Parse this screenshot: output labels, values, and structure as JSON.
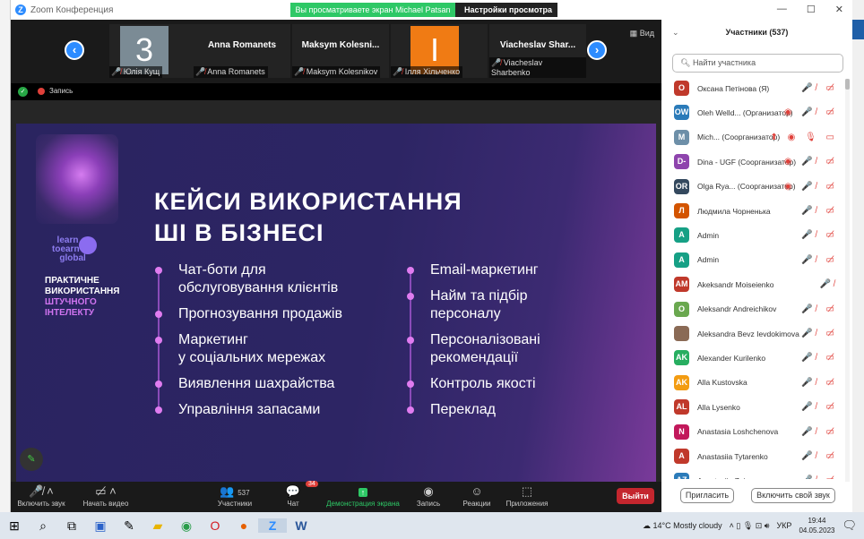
{
  "window": {
    "title": "Zoom Конференция",
    "min": "—",
    "max": "☐",
    "close": "✕"
  },
  "share_banner": {
    "text": "Вы просматриваете экран Michael Patsan",
    "settings": "Настройки просмотра",
    "chevron": "⌄"
  },
  "strip": {
    "tiles": [
      {
        "avatar": "3",
        "avatar_color": "#7b8b95",
        "label": "Юлія Кущ"
      },
      {
        "name": "Anna Romanets",
        "label": "Anna Romanets"
      },
      {
        "name": "Maksym  Kolesni...",
        "label": "Maksym Kolesnikov"
      },
      {
        "avatar": "I",
        "avatar_color": "#f07b14",
        "label": "Ілля Хільченко"
      },
      {
        "name": "Viacheslav  Shar...",
        "label": "Viacheslav Sharbenko"
      }
    ],
    "view": "Вид"
  },
  "recording": {
    "label": "Запись"
  },
  "slide": {
    "title_line1": "КЕЙСИ ВИКОРИСТАННЯ",
    "title_line2": "ШІ В БІЗНЕСІ",
    "logo": [
      "learn",
      "toearn",
      "global"
    ],
    "subtitle_white": [
      "ПРАКТИЧНЕ",
      "ВИКОРИСТАННЯ"
    ],
    "subtitle_pink": [
      "ШТУЧНОГО",
      "ІНТЕЛЕКТУ"
    ],
    "left": [
      "Чат-боти для\nобслуговування клієнтів",
      "Прогнозування продажів",
      "Маркетинг\nу соціальних мережах",
      "Виявлення шахрайства",
      "Управління запасами"
    ],
    "right": [
      "Email-маркетинг",
      "Найм та підбір\nперсоналу",
      "Персоналізовані\nрекомендації",
      "Контроль якості",
      "Переклад"
    ]
  },
  "toolbar": {
    "audio": "Включить звук",
    "video": "Начать видео",
    "participants": "Участники",
    "participants_count": "537",
    "chat": "Чат",
    "chat_badge": "34",
    "share": "Демонстрация экрана",
    "record": "Запись",
    "reactions": "Реакции",
    "apps": "Приложения",
    "leave": "Выйти"
  },
  "panel": {
    "title": "Участники (537)",
    "search_placeholder": "Найти участника",
    "invite": "Пригласить",
    "unmute": "Включить свой звук",
    "participants": [
      {
        "initials": "О",
        "color": "#c0392b",
        "name": "Оксана Петінова (Я)",
        "icons": "🎤̸ ▭̸"
      },
      {
        "initials": "OW",
        "color": "#2b7bb9",
        "name": "Oleh Welld...  (Организатор)",
        "icons": "◉ 🎤̸ ▭̸"
      },
      {
        "initials": "M",
        "color": "#6d8fa8",
        "name": "Mich...  (Соорганизатор)",
        "icons": "⬆ ◉ 🎙 ▭"
      },
      {
        "initials": "D-",
        "color": "#8e44ad",
        "name": "Dina - UGF (Соорганизатор)",
        "icons": "◉ 🎤̸ ▭̸"
      },
      {
        "initials": "OR",
        "color": "#34495e",
        "name": "Olga Rya...  (Соорганизатор)",
        "icons": "◉ 🎤̸ ▭̸"
      },
      {
        "initials": "Л",
        "color": "#d35400",
        "name": "Людмила Чорненька",
        "icons": "🎤̸ ▭̸"
      },
      {
        "initials": "A",
        "color": "#16a085",
        "name": "Admin",
        "icons": "🎤̸ ▭̸"
      },
      {
        "initials": "A",
        "color": "#16a085",
        "name": "Admin",
        "icons": "🎤̸ ▭̸"
      },
      {
        "initials": "AM",
        "color": "#c0392b",
        "name": "Akeksandr Moiseienko",
        "icons": "🎤̸"
      },
      {
        "initials": "O",
        "color": "#6aa84f",
        "name": "Aleksandr Andreichikov",
        "icons": "🎤̸ ▭̸"
      },
      {
        "initials": "",
        "color": "#8a6a55",
        "name": "Aleksandra Bevz Ievdokimova",
        "icons": "🎤̸ ▭̸"
      },
      {
        "initials": "AK",
        "color": "#27ae60",
        "name": "Alexander Kurilenko",
        "icons": "🎤̸ ▭̸"
      },
      {
        "initials": "AK",
        "color": "#f39c12",
        "name": "Alla Kustovska",
        "icons": "🎤̸ ▭̸"
      },
      {
        "initials": "AL",
        "color": "#c0392b",
        "name": "Alla Lysenko",
        "icons": "🎤̸ ▭̸"
      },
      {
        "initials": "N",
        "color": "#c2185b",
        "name": "Anastasia Loshchenova",
        "icons": "🎤̸ ▭̸"
      },
      {
        "initials": "A",
        "color": "#c0392b",
        "name": "Anastasiia Tytarenko",
        "icons": "🎤̸ ▭̸"
      },
      {
        "initials": "AZ",
        "color": "#2b7bb9",
        "name": "Anastasiia Zuieva",
        "icons": "🎤̸ ▭̸"
      }
    ]
  },
  "taskbar": {
    "weather": "14°C  Mostly cloudy",
    "lang": "УКР",
    "time": "19:44",
    "date": "04.05.2023"
  }
}
